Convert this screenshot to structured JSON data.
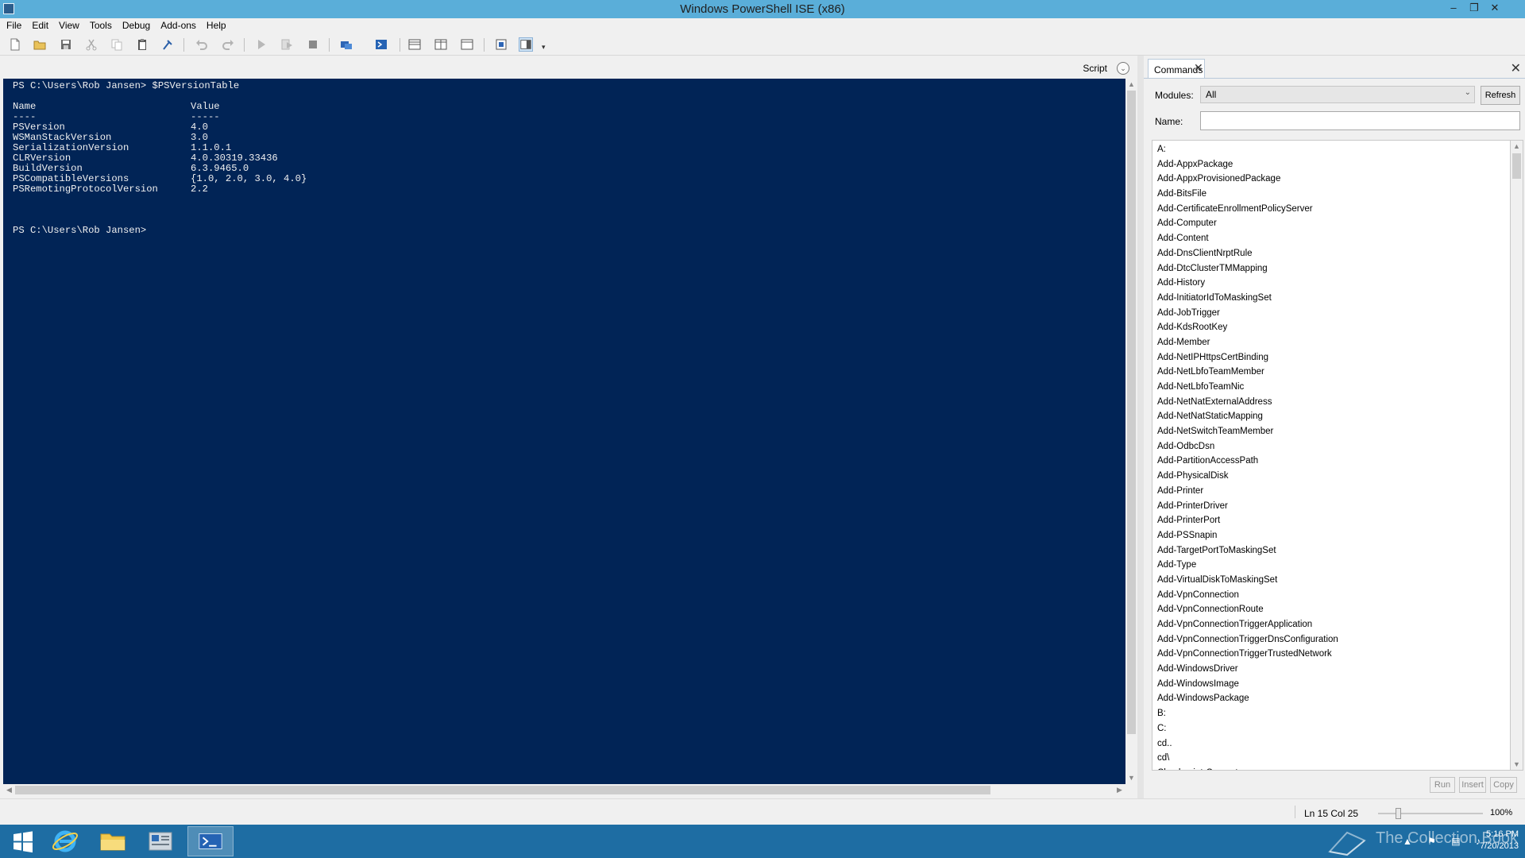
{
  "window": {
    "title": "Windows PowerShell ISE (x86)",
    "controls": [
      "minimize-icon",
      "restore-icon",
      "close-icon"
    ]
  },
  "menu": [
    "File",
    "Edit",
    "View",
    "Tools",
    "Debug",
    "Add-ons",
    "Help"
  ],
  "toolbar": {
    "icons": [
      "new-file-icon",
      "open-folder-icon",
      "save-icon",
      "cut-icon",
      "copy-icon",
      "paste-icon",
      "clear-console-icon",
      "undo-icon",
      "redo-icon",
      "run-icon",
      "run-selection-icon",
      "stop-icon",
      "remote-powershell-icon",
      "powershell-console-icon",
      "show-script-top-icon",
      "show-script-right-icon",
      "show-script-maximized-icon",
      "show-script-pane-icon",
      "show-command-addon-icon"
    ]
  },
  "script_strip": {
    "label": "Script"
  },
  "console": {
    "prompt_command": "PS C:\\Users\\Rob Jansen> $PSVersionTable",
    "table_header": [
      "Name",
      "Value"
    ],
    "table_rule": [
      "----",
      "-----"
    ],
    "rows": [
      [
        "PSVersion",
        "4.0"
      ],
      [
        "WSManStackVersion",
        "3.0"
      ],
      [
        "SerializationVersion",
        "1.1.0.1"
      ],
      [
        "CLRVersion",
        "4.0.30319.33436"
      ],
      [
        "BuildVersion",
        "6.3.9465.0"
      ],
      [
        "PSCompatibleVersions",
        "{1.0, 2.0, 3.0, 4.0}"
      ],
      [
        "PSRemotingProtocolVersion",
        "2.2"
      ]
    ],
    "prompt_final": "PS C:\\Users\\Rob Jansen>"
  },
  "commands_pane": {
    "tab_label": "Commands",
    "modules_label": "Modules:",
    "modules_value": "All",
    "refresh_label": "Refresh",
    "name_label": "Name:",
    "name_value": "",
    "items": [
      "A:",
      "Add-AppxPackage",
      "Add-AppxProvisionedPackage",
      "Add-BitsFile",
      "Add-CertificateEnrollmentPolicyServer",
      "Add-Computer",
      "Add-Content",
      "Add-DnsClientNrptRule",
      "Add-DtcClusterTMMapping",
      "Add-History",
      "Add-InitiatorIdToMaskingSet",
      "Add-JobTrigger",
      "Add-KdsRootKey",
      "Add-Member",
      "Add-NetIPHttpsCertBinding",
      "Add-NetLbfoTeamMember",
      "Add-NetLbfoTeamNic",
      "Add-NetNatExternalAddress",
      "Add-NetNatStaticMapping",
      "Add-NetSwitchTeamMember",
      "Add-OdbcDsn",
      "Add-PartitionAccessPath",
      "Add-PhysicalDisk",
      "Add-Printer",
      "Add-PrinterDriver",
      "Add-PrinterPort",
      "Add-PSSnapin",
      "Add-TargetPortToMaskingSet",
      "Add-Type",
      "Add-VirtualDiskToMaskingSet",
      "Add-VpnConnection",
      "Add-VpnConnectionRoute",
      "Add-VpnConnectionTriggerApplication",
      "Add-VpnConnectionTriggerDnsConfiguration",
      "Add-VpnConnectionTriggerTrustedNetwork",
      "Add-WindowsDriver",
      "Add-WindowsImage",
      "Add-WindowsPackage",
      "B:",
      "C:",
      "cd..",
      "cd\\",
      "Checkpoint-Computer"
    ],
    "buttons": {
      "run": "Run",
      "insert": "Insert",
      "copy": "Copy"
    }
  },
  "status": {
    "position": "Ln 15  Col 25",
    "zoom": "100%",
    "zoom_fraction": 0.17
  },
  "taskbar": {
    "items": [
      "start-icon",
      "internet-explorer-icon",
      "file-explorer-icon",
      "server-manager-icon",
      "powershell-ise-icon"
    ],
    "active_item": "powershell-ise-icon",
    "watermark": "The Collection Book",
    "time": "5:16 PM",
    "date": "7/20/2013"
  },
  "colors": {
    "console_bg": "#012456",
    "console_fg": "#f0f0f0",
    "titlebar": "#5aaed9",
    "taskbar": "#1e6da3"
  }
}
